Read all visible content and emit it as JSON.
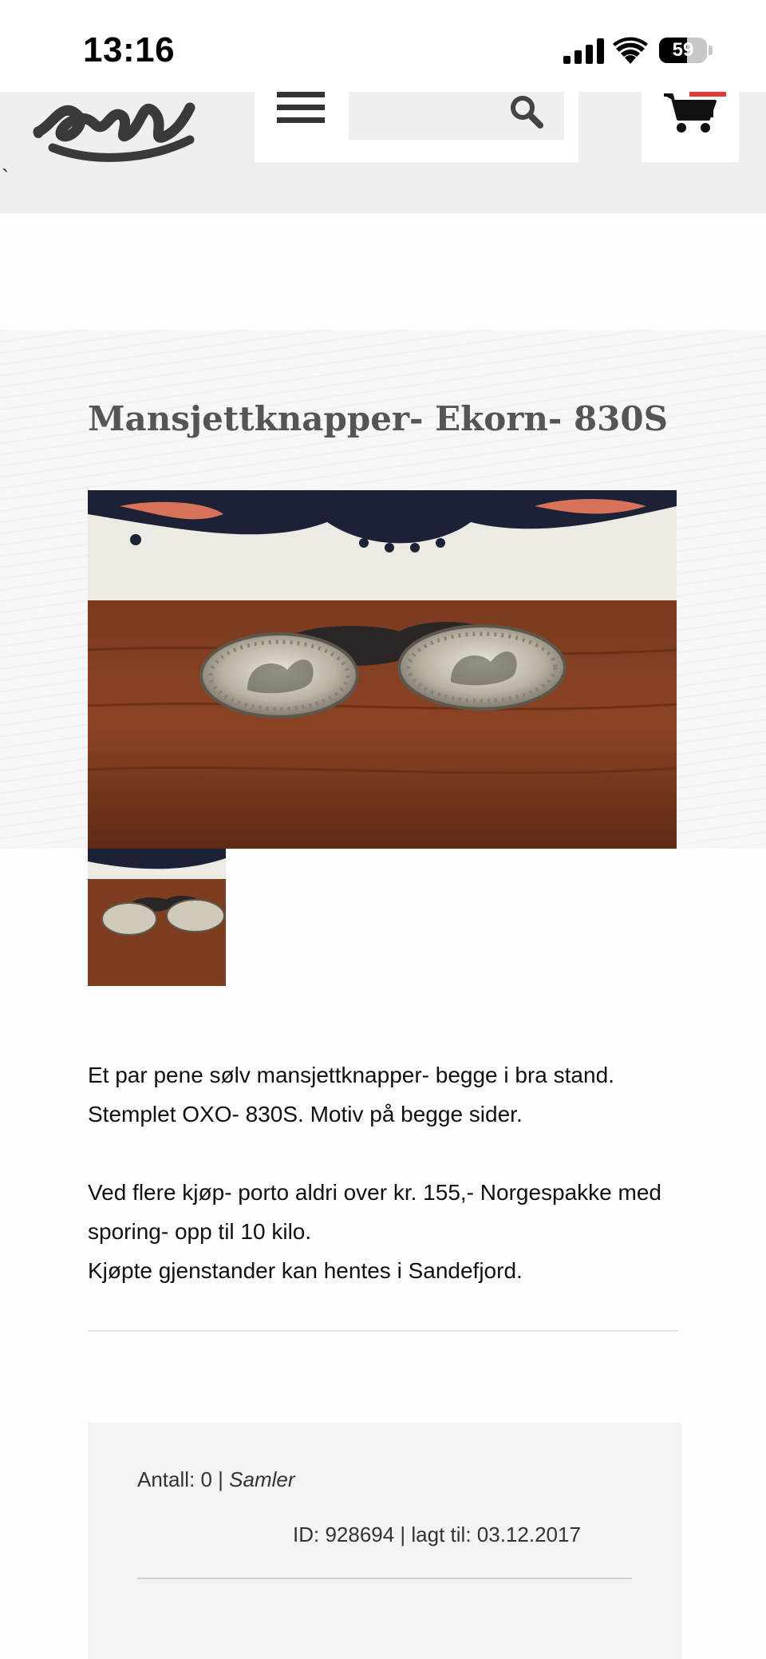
{
  "status_bar": {
    "time": "13:16",
    "battery_level": "59",
    "battery_fraction": 0.59,
    "icons": [
      "cellular-signal-icon",
      "wifi-icon",
      "battery-icon"
    ]
  },
  "header": {
    "logo_icon": "epla-logo-icon",
    "stray_mark": "`",
    "menu_icon": "hamburger-menu-icon",
    "search": {
      "value": "",
      "icon": "search-icon"
    },
    "cart_icon": "shopping-cart-icon"
  },
  "product": {
    "title": "Mansjettknapper- Ekorn- 830S",
    "description": [
      "Et par pene sølv mansjettknapper- begge i bra stand.",
      "Stemplet OXO- 830S. Motiv på begge sider.",
      "",
      "Ved flere kjøp- porto aldri over kr. 155,- Norgespakke med sporing- opp til 10 kilo.",
      "Kjøpte gjenstander kan hentes i Sandefjord."
    ]
  },
  "info": {
    "quantity_label": "Antall: 0 |",
    "category": "Samler",
    "id_line": "ID: 928694 | lagt til: 03.12.2017"
  },
  "colors": {
    "header_bg": "#efefef",
    "title_color": "#555555",
    "cart_badge": "#e53935",
    "info_box_bg": "#f3f3f3"
  }
}
